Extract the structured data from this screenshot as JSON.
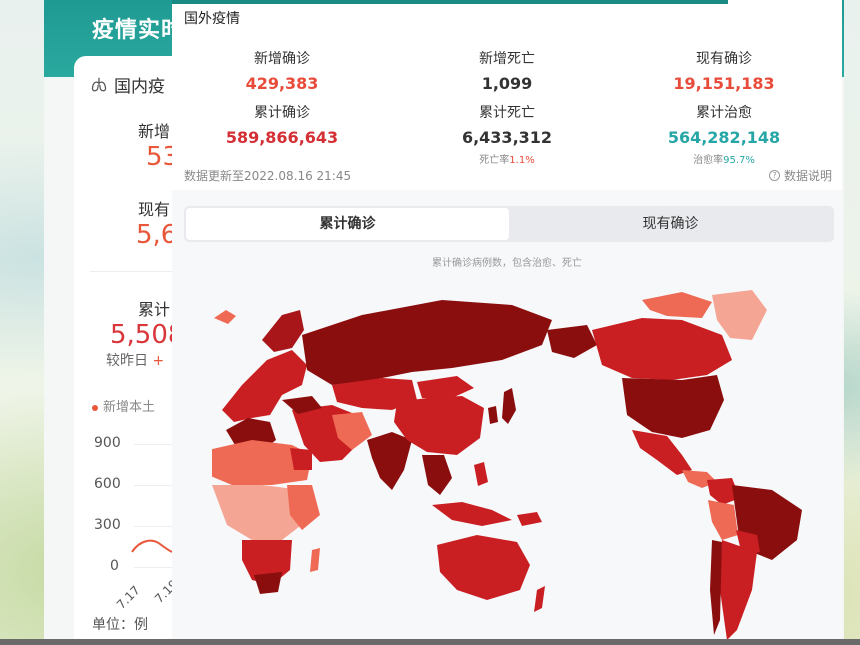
{
  "colors": {
    "confirm_red": "#e84b3a",
    "deep_red": "#d42f35",
    "cured_teal": "#26a6a6",
    "header_teal": "#1f9a93",
    "map_dark": "#8b0e0e",
    "map_mid": "#c91f22",
    "map_light": "#ef6a55",
    "map_pale": "#f5a594"
  },
  "back": {
    "title": "疫情实时",
    "card_title": "国内疫",
    "new_confirm_label": "新增",
    "new_confirm_value": "53",
    "current_confirm_label": "现有",
    "current_confirm_value": "5,6",
    "total_label": "累计",
    "total_value": "5,508",
    "compare_label": "较昨日",
    "compare_sign": "+",
    "legend": "新增本土",
    "y_ticks": [
      "900",
      "600",
      "300",
      "0"
    ],
    "x_ticks": [
      "7.17",
      "7.19"
    ],
    "unit": "单位：例",
    "icon": "lung-icon"
  },
  "front": {
    "section_title": "国外疫情",
    "stats": [
      {
        "label": "新增确诊",
        "value": "429,383",
        "tone": "red"
      },
      {
        "label": "新增死亡",
        "value": "1,099",
        "tone": "dark"
      },
      {
        "label": "现有确诊",
        "value": "19,151,183",
        "tone": "red"
      },
      {
        "label": "累计确诊",
        "value": "589,866,643",
        "tone": "red-deep"
      },
      {
        "label": "累计死亡",
        "value": "6,433,312",
        "tone": "dark",
        "note_label": "死亡率",
        "note_value": "1.1%"
      },
      {
        "label": "累计治愈",
        "value": "564,282,148",
        "tone": "teal",
        "note_label": "治愈率",
        "note_value": "95.7%"
      }
    ],
    "update_time": "数据更新至2022.08.16 21:45",
    "data_explain": "数据说明",
    "tabs": [
      "累计确诊",
      "现有确诊"
    ],
    "active_tab": 0,
    "map_caption": "累计确诊病例数，包含治愈、死亡"
  }
}
